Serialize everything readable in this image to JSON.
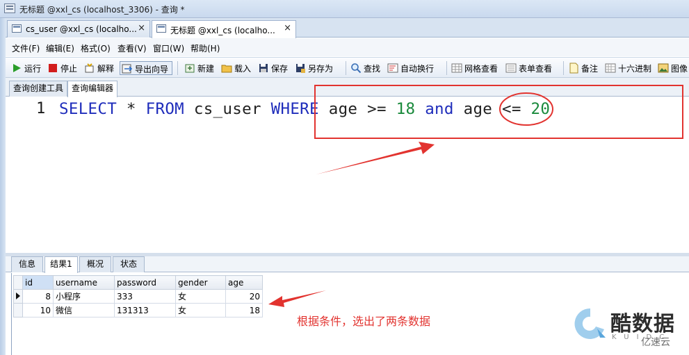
{
  "window": {
    "title": "无标题 @xxl_cs (localhost_3306) - 查询 *"
  },
  "doc_tabs": [
    {
      "label": "cs_user @xxl_cs (localho...",
      "close": "×"
    },
    {
      "label": "无标题 @xxl_cs (localho...",
      "close": "×"
    }
  ],
  "menu": {
    "file": "文件(F)",
    "edit": "编辑(E)",
    "format": "格式(O)",
    "view": "查看(V)",
    "window": "窗口(W)",
    "help": "帮助(H)"
  },
  "toolbar": {
    "run": "运行",
    "stop": "停止",
    "explain": "解释",
    "export_wizard": "导出向导",
    "new": "新建",
    "load": "载入",
    "save": "保存",
    "save_as": "另存为",
    "find": "查找",
    "word_wrap": "自动换行",
    "grid_view": "网格查看",
    "form_view": "表单查看",
    "memo": "备注",
    "hex": "十六进制",
    "image": "图像"
  },
  "query_tabs": {
    "builder": "查询创建工具",
    "editor": "查询编辑器"
  },
  "editor": {
    "line_number": "1",
    "tokens": {
      "select": "SELECT",
      "star": " * ",
      "from": "FROM",
      "table": " cs_user ",
      "where": "WHERE",
      "cond1": " age >= ",
      "val1": "18",
      "and": " and ",
      "cond2": "age <= ",
      "val2": "20"
    }
  },
  "result_tabs": {
    "info": "信息",
    "result1": "结果1",
    "overview": "概况",
    "status": "状态"
  },
  "grid": {
    "columns": [
      "id",
      "username",
      "password",
      "gender",
      "age"
    ],
    "rows": [
      [
        "8",
        "小程序",
        "333",
        "女",
        "20"
      ],
      [
        "10",
        "微信",
        "131313",
        "女",
        "18"
      ]
    ]
  },
  "annotation": {
    "note": "根据条件，选出了两条数据",
    "color": "#e2332f"
  },
  "watermark": {
    "brand": "酷数据",
    "sub": "KUIDC",
    "partner": "亿速云"
  },
  "colors": {
    "keyword": "#1f2dbb",
    "number": "#1a8a3c",
    "annotation": "#e2332f"
  }
}
